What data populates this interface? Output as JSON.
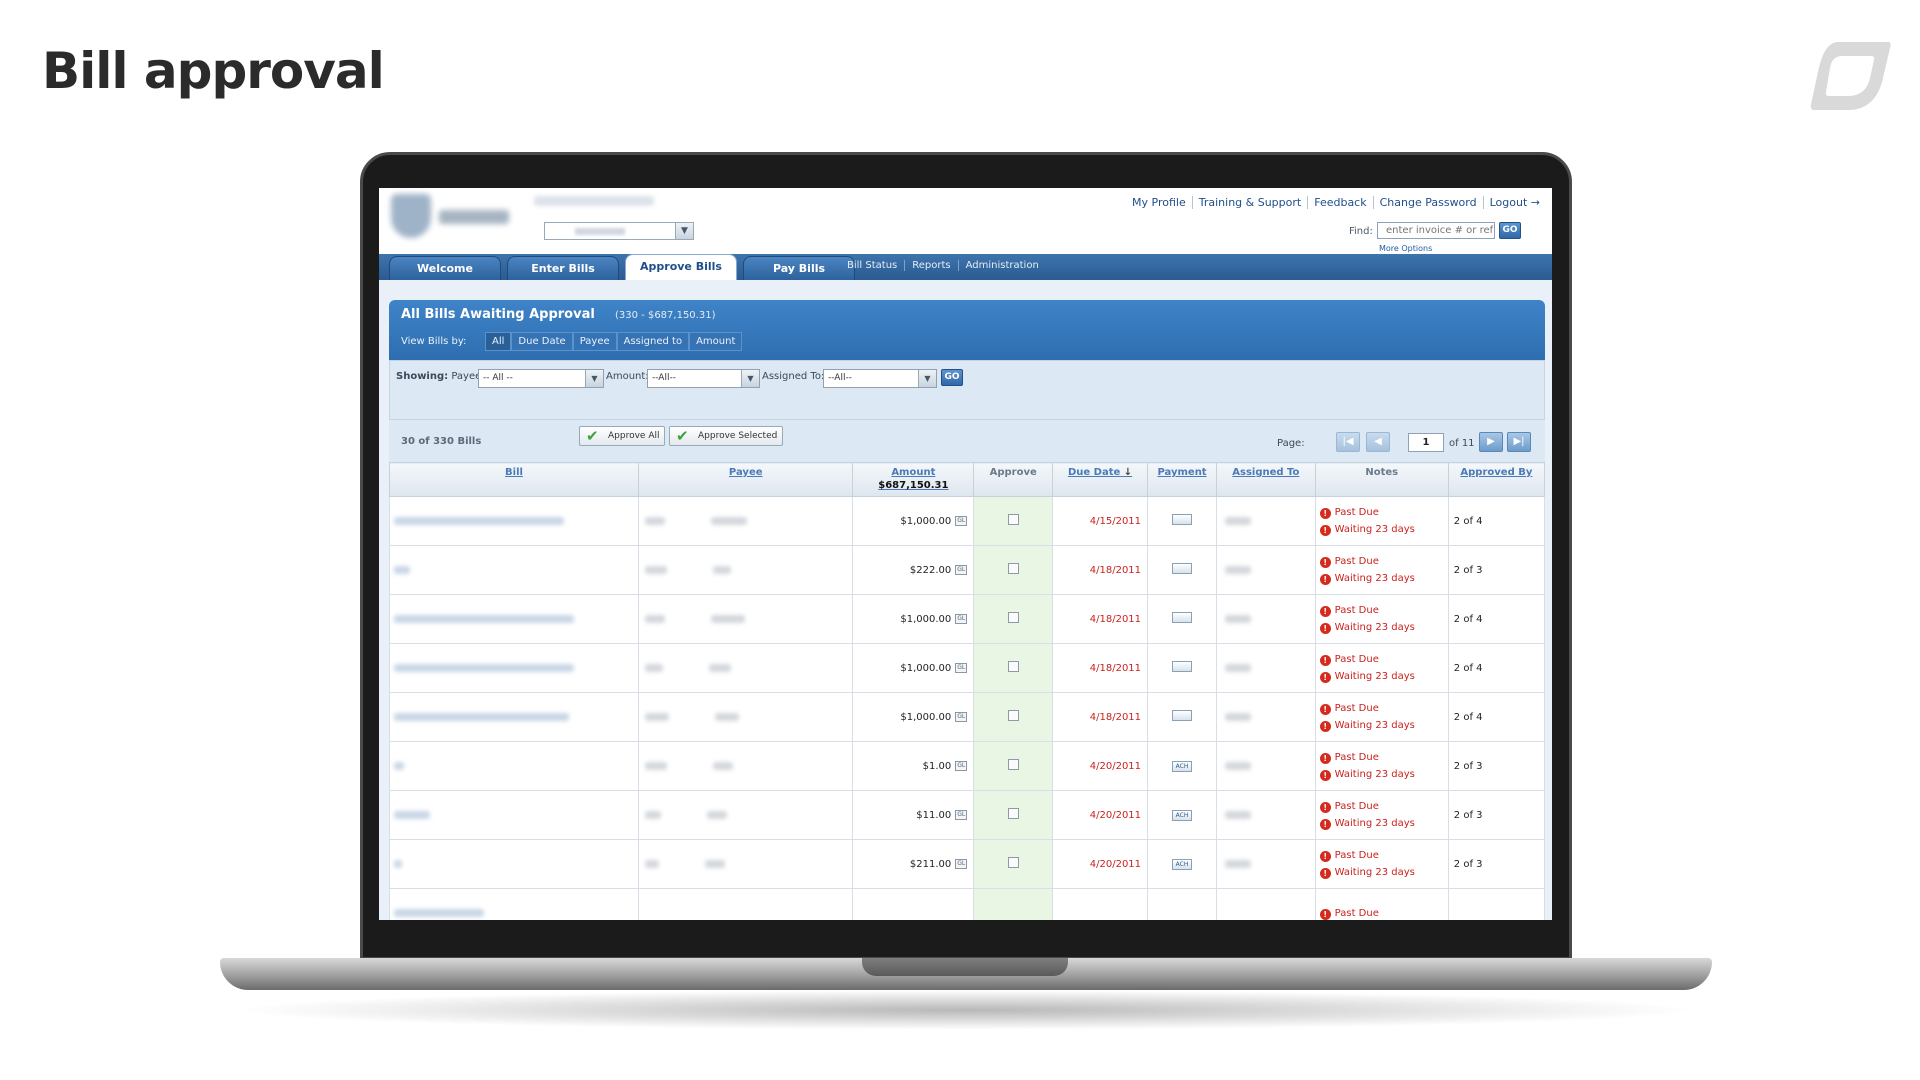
{
  "slide": {
    "title": "Bill approval",
    "brand_color": "#d9d9d9"
  },
  "header": {
    "top_links": [
      "My Profile",
      "Training & Support",
      "Feedback",
      "Change Password",
      "Logout →"
    ],
    "find_label": "Find:",
    "find_placeholder": "enter invoice # or ref #",
    "find_go": "GO",
    "more_options": "More Options"
  },
  "nav": {
    "tabs": [
      {
        "label": "Welcome",
        "active": false
      },
      {
        "label": "Enter Bills",
        "active": false
      },
      {
        "label": "Approve Bills",
        "active": true
      },
      {
        "label": "Pay Bills",
        "active": false
      }
    ],
    "sub_links": [
      "Bill Status",
      "Reports",
      "Administration"
    ]
  },
  "panel": {
    "title": "All Bills Awaiting Approval",
    "count": "(330 - $687,150.31)",
    "view_by_label": "View Bills by:",
    "view_by_tabs": [
      "All",
      "Due Date",
      "Payee",
      "Assigned to",
      "Amount"
    ],
    "view_by_active": "All"
  },
  "filters": {
    "showing_label": "Showing:",
    "payee_label": "Payee:",
    "payee_value": "-- All --",
    "amount_label": "Amount:",
    "amount_value": "--All--",
    "assigned_label": "Assigned To:",
    "assigned_value": "--All--",
    "go": "GO"
  },
  "toolbar": {
    "bill_count": "30 of 330 Bills",
    "approve_all": "Approve All",
    "approve_selected": "Approve Selected",
    "page_label": "Page:",
    "page_value": "1",
    "page_of": "of 11"
  },
  "table": {
    "headers": {
      "bill": "Bill",
      "payee": "Payee",
      "amount": "Amount",
      "amount_total": "$687,150.31",
      "approve": "Approve",
      "due_date": "Due Date",
      "sort_arrow": "↓",
      "payment": "Payment",
      "assigned_to": "Assigned To",
      "notes": "Notes",
      "approved_by": "Approved By"
    },
    "gl_label": "GL",
    "ach_label": "ACH",
    "rows": [
      {
        "amount": "$1,000.00",
        "due": "4/15/2011",
        "payment": "check",
        "note1": "Past Due",
        "note2": "Waiting 23 days",
        "approved_by": "2 of 4"
      },
      {
        "amount": "$222.00",
        "due": "4/18/2011",
        "payment": "check",
        "note1": "Past Due",
        "note2": "Waiting 23 days",
        "approved_by": "2 of 3"
      },
      {
        "amount": "$1,000.00",
        "due": "4/18/2011",
        "payment": "check",
        "note1": "Past Due",
        "note2": "Waiting 23 days",
        "approved_by": "2 of 4"
      },
      {
        "amount": "$1,000.00",
        "due": "4/18/2011",
        "payment": "check",
        "note1": "Past Due",
        "note2": "Waiting 23 days",
        "approved_by": "2 of 4"
      },
      {
        "amount": "$1,000.00",
        "due": "4/18/2011",
        "payment": "check",
        "note1": "Past Due",
        "note2": "Waiting 23 days",
        "approved_by": "2 of 4"
      },
      {
        "amount": "$1.00",
        "due": "4/20/2011",
        "payment": "ach",
        "note1": "Past Due",
        "note2": "Waiting 23 days",
        "approved_by": "2 of 3"
      },
      {
        "amount": "$11.00",
        "due": "4/20/2011",
        "payment": "ach",
        "note1": "Past Due",
        "note2": "Waiting 23 days",
        "approved_by": "2 of 3"
      },
      {
        "amount": "$211.00",
        "due": "4/20/2011",
        "payment": "ach",
        "note1": "Past Due",
        "note2": "Waiting 23 days",
        "approved_by": "2 of 3"
      },
      {
        "amount": "",
        "due": "",
        "payment": "",
        "note1": "Past Due",
        "note2": "",
        "approved_by": ""
      }
    ]
  }
}
